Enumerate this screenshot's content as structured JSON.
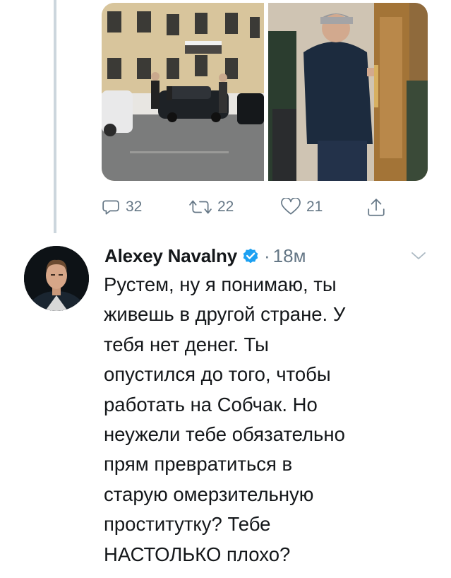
{
  "previous_tweet": {
    "stats": {
      "replies": "32",
      "retweets": "22",
      "likes": "21"
    },
    "icons": [
      "reply-icon",
      "retweet-icon",
      "like-icon",
      "share-icon"
    ]
  },
  "tweet": {
    "author_name": "Alexey Navalny",
    "separator": "·",
    "timestamp": "18м",
    "text_lines": [
      "Рустем, ну я понимаю, ты",
      "живешь в другой стране. У",
      "тебя нет денег. Ты",
      "опустился до того, чтобы",
      "работать на Собчак. Но",
      "неужели тебе обязательно",
      "прям превратиться в",
      "старую омерзительную",
      "проститутку? Тебе",
      "НАСТОЛЬКО плохо?"
    ]
  },
  "colors": {
    "text": "#14171a",
    "secondary": "#657786",
    "verified": "#1da1f2",
    "thread_line": "#ccd6dd"
  }
}
